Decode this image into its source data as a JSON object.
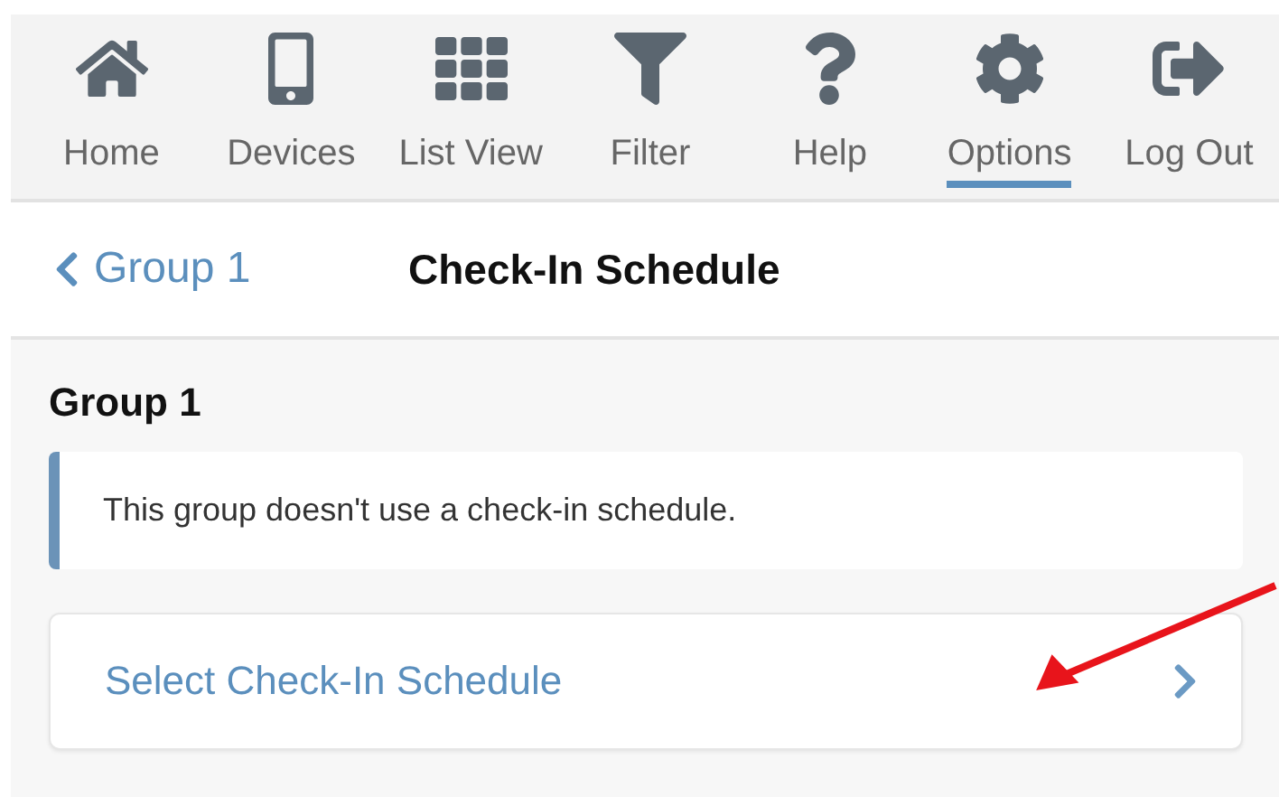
{
  "toolbar": {
    "items": [
      {
        "label": "Home",
        "kind": "home",
        "selected": false
      },
      {
        "label": "Devices",
        "kind": "phone",
        "selected": false
      },
      {
        "label": "List View",
        "kind": "grid",
        "selected": false
      },
      {
        "label": "Filter",
        "kind": "filter",
        "selected": false
      },
      {
        "label": "Help",
        "kind": "help",
        "selected": false
      },
      {
        "label": "Options",
        "kind": "gear",
        "selected": true
      },
      {
        "label": "Log Out",
        "kind": "logout",
        "selected": false
      }
    ]
  },
  "header": {
    "back_link": "Group 1",
    "title": "Check-In Schedule"
  },
  "content": {
    "section_title": "Group 1",
    "notice": "This group doesn't use a check-in schedule.",
    "action": "Select Check-In Schedule"
  }
}
